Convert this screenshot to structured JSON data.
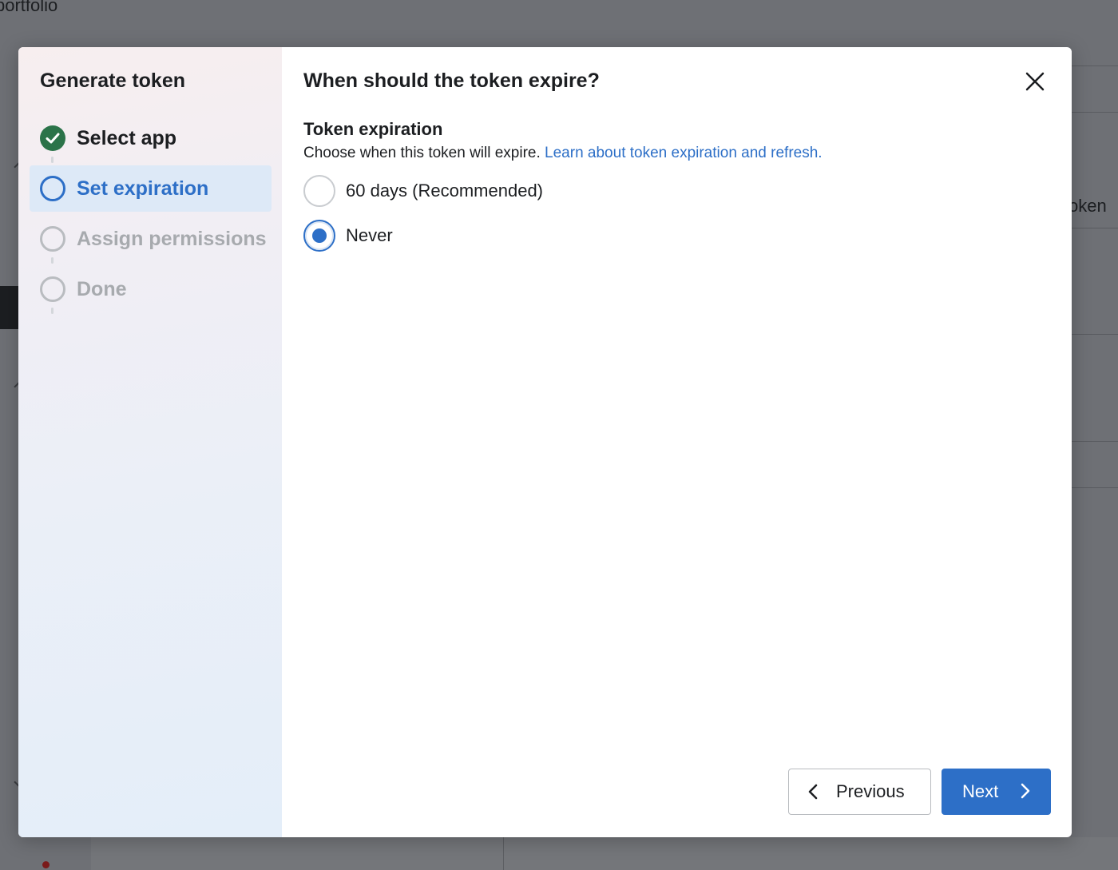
{
  "background": {
    "top_left_text": "portfolio",
    "right_partial_text": "oken"
  },
  "modal": {
    "sidebar": {
      "title": "Generate token",
      "steps": [
        {
          "label": "Select app",
          "state": "done",
          "icon": "check-circle-icon"
        },
        {
          "label": "Set expiration",
          "state": "current",
          "icon": "circle-outline-icon"
        },
        {
          "label": "Assign permissions",
          "state": "pending",
          "icon": "circle-outline-icon"
        },
        {
          "label": "Done",
          "state": "pending",
          "icon": "circle-outline-icon"
        }
      ]
    },
    "content": {
      "title": "When should the token expire?",
      "section_title": "Token expiration",
      "description": "Choose when this token will expire.",
      "link_text": "Learn about token expiration and refresh.",
      "options": [
        {
          "label": "60 days (Recommended)",
          "checked": false
        },
        {
          "label": "Never",
          "checked": true
        }
      ]
    },
    "footer": {
      "previous_label": "Previous",
      "next_label": "Next"
    },
    "close_icon": "close-icon"
  },
  "colors": {
    "accent": "#2d6fc7",
    "success": "#2b7349",
    "overlay": "#6e7075",
    "pending": "#a7aaae"
  }
}
